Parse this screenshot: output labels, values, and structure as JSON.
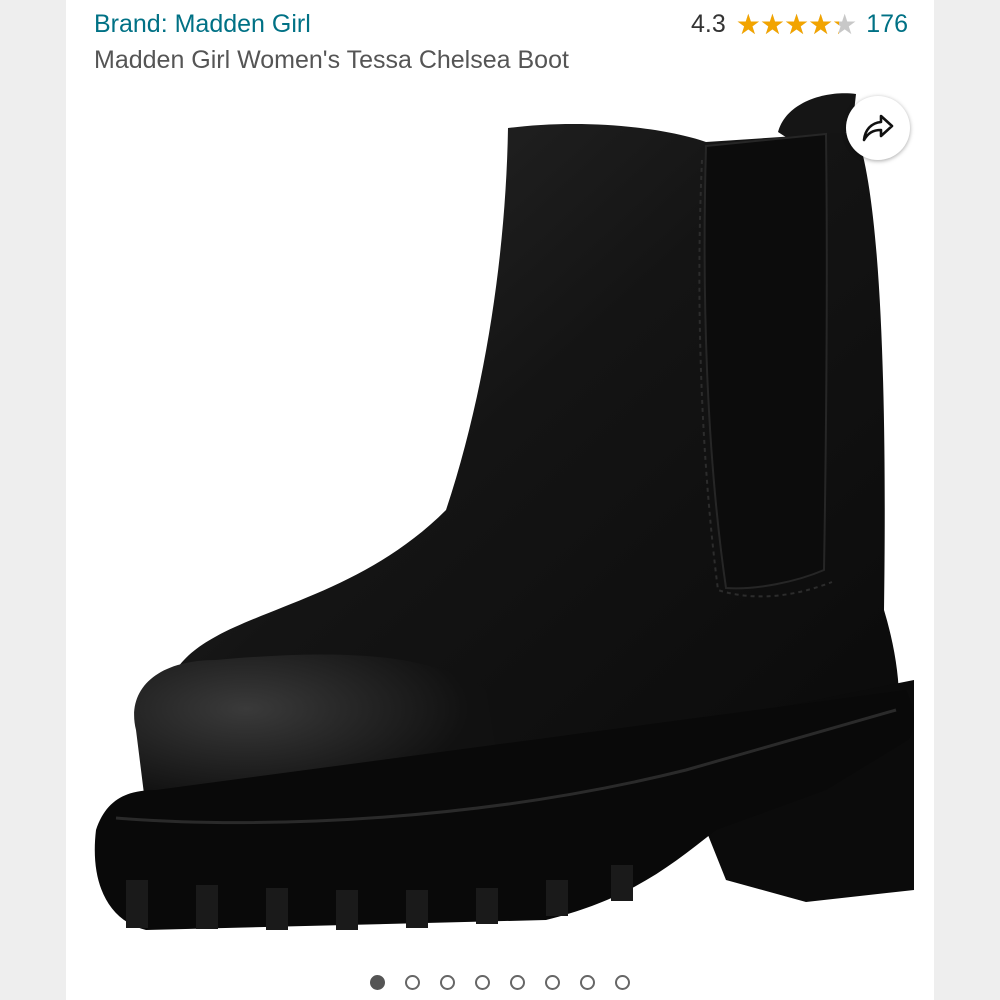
{
  "product": {
    "brand": "Brand: Madden Girl",
    "title": "Madden Girl Women's Tessa Chelsea Boot"
  },
  "rating": {
    "value": "4.3",
    "stars_fraction": 0.86,
    "count": "176"
  },
  "image": {
    "alt": "Black Chelsea boot with lug sole",
    "current_index": 0,
    "total": 8
  },
  "icons": {
    "share": "share-arrow-icon"
  },
  "colors": {
    "link": "#007185",
    "star": "#f2a400",
    "text": "#555555"
  }
}
